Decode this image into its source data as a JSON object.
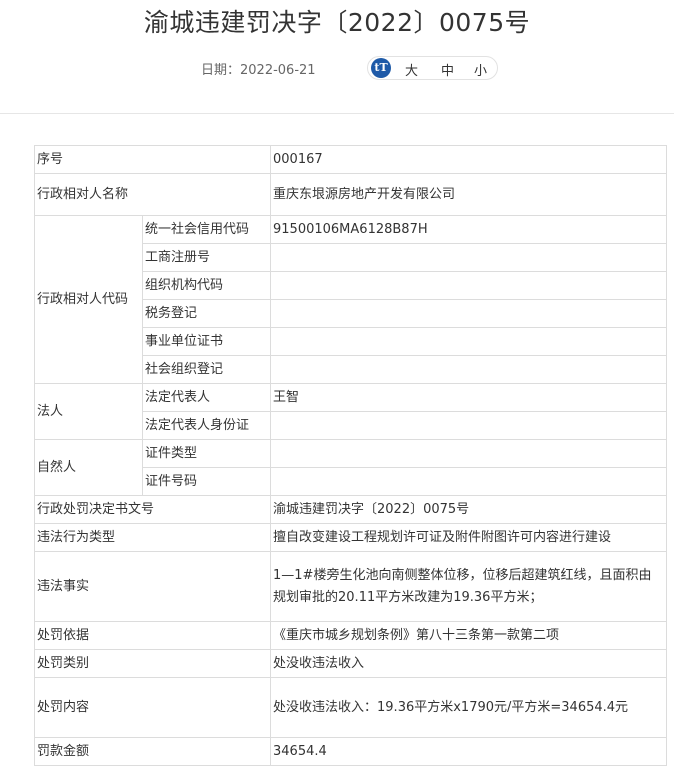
{
  "title": "渝城违建罚决字〔2022〕0075号",
  "date_label": "日期：",
  "date_value": "2022-06-21",
  "font_controls": {
    "icon": "tT",
    "large": "大",
    "medium": "中",
    "small": "小"
  },
  "rows": {
    "serial": {
      "label": "序号",
      "value": "000167"
    },
    "party_name": {
      "label": "行政相对人名称",
      "value": "重庆东垠源房地产开发有限公司"
    },
    "party_code": {
      "label": "行政相对人代码",
      "items": [
        {
          "label": "统一社会信用代码",
          "value": "91500106MA6128B87H"
        },
        {
          "label": "工商注册号",
          "value": ""
        },
        {
          "label": "组织机构代码",
          "value": ""
        },
        {
          "label": "税务登记",
          "value": ""
        },
        {
          "label": "事业单位证书",
          "value": ""
        },
        {
          "label": "社会组织登记",
          "value": ""
        }
      ]
    },
    "legal_person": {
      "label": "法人",
      "items": [
        {
          "label": "法定代表人",
          "value": "王智"
        },
        {
          "label": "法定代表人身份证",
          "value": ""
        }
      ]
    },
    "natural_person": {
      "label": "自然人",
      "items": [
        {
          "label": "证件类型",
          "value": ""
        },
        {
          "label": "证件号码",
          "value": ""
        }
      ]
    },
    "decision_no": {
      "label": "行政处罚决定书文号",
      "value": "渝城违建罚决字〔2022〕0075号"
    },
    "violation_type": {
      "label": "违法行为类型",
      "value": "擅自改变建设工程规划许可证及附件附图许可内容进行建设"
    },
    "facts": {
      "label": "违法事实",
      "value": "1—1#楼旁生化池向南侧整体位移，位移后超建筑红线，且面积由规划审批的20.11平方米改建为19.36平方米；"
    },
    "basis": {
      "label": "处罚依据",
      "value": "《重庆市城乡规划条例》第八十三条第一款第二项"
    },
    "category": {
      "label": "处罚类别",
      "value": "处没收违法收入"
    },
    "content": {
      "label": "处罚内容",
      "value": "处没收违法收入：19.36平方米x1790元/平方米=34654.4元"
    },
    "fine": {
      "label": "罚款金额",
      "value": "34654.4"
    }
  }
}
